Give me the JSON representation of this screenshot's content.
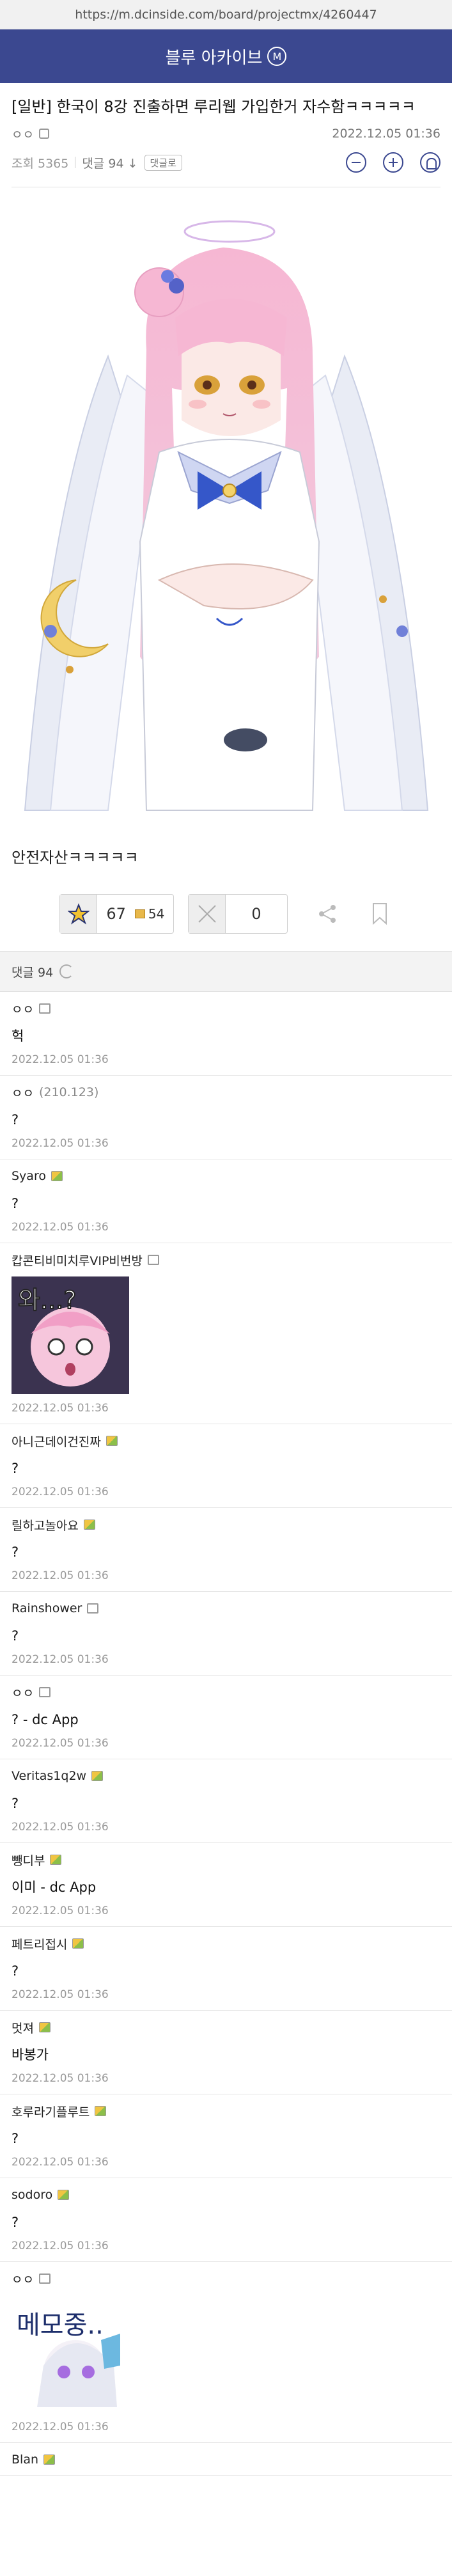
{
  "browser": {
    "url": "https://m.dcinside.com/board/projectmx/4260447"
  },
  "header": {
    "title": "블루 아카이브",
    "badge": "M"
  },
  "post": {
    "title": "[일반] 한국이 8강 진출하면 루리웹 가입한거 자수함ㅋㅋㅋㅋㅋ",
    "author": "ㅇㅇ",
    "datetime": "2022.12.05 01:36",
    "views": "조회 5365",
    "comments_link": "댓글 94",
    "tag_button": "댓글로",
    "body": "안전자산ㅋㅋㅋㅋㅋ"
  },
  "votes": {
    "up": "67",
    "gallery_up": "54",
    "down": "0"
  },
  "comments_header": "댓글 94",
  "comments": [
    {
      "author": "ㅇㅇ",
      "ip": "",
      "badge": "fixed",
      "text": "헉",
      "date": "2022.12.05 01:36",
      "image": ""
    },
    {
      "author": "ㅇㅇ",
      "ip": "(210.123)",
      "badge": "",
      "text": "?",
      "date": "2022.12.05 01:36",
      "image": ""
    },
    {
      "author": "Syaro",
      "ip": "",
      "badge": "half",
      "text": "?",
      "date": "2022.12.05 01:36",
      "image": ""
    },
    {
      "author": "캅콘티비미치루VIP비번방",
      "ip": "",
      "badge": "fixed",
      "text": "",
      "date": "2022.12.05 01:36",
      "image": "sticker-surprised"
    },
    {
      "author": "아니근데이건진짜",
      "ip": "",
      "badge": "half",
      "text": "?",
      "date": "2022.12.05 01:36",
      "image": ""
    },
    {
      "author": "릴하고놀아요",
      "ip": "",
      "badge": "half",
      "text": "?",
      "date": "2022.12.05 01:36",
      "image": ""
    },
    {
      "author": "Rainshower",
      "ip": "",
      "badge": "fixed",
      "text": "?",
      "date": "2022.12.05 01:36",
      "image": ""
    },
    {
      "author": "ㅇㅇ",
      "ip": "",
      "badge": "fixed",
      "text": "? - dc App",
      "date": "2022.12.05 01:36",
      "image": ""
    },
    {
      "author": "Veritas1q2w",
      "ip": "",
      "badge": "half",
      "text": "?",
      "date": "2022.12.05 01:36",
      "image": ""
    },
    {
      "author": "뺑디부",
      "ip": "",
      "badge": "half",
      "text": "이미 - dc App",
      "date": "2022.12.05 01:36",
      "image": ""
    },
    {
      "author": "페트리접시",
      "ip": "",
      "badge": "half",
      "text": "?",
      "date": "2022.12.05 01:36",
      "image": ""
    },
    {
      "author": "멋져",
      "ip": "",
      "badge": "half",
      "text": "바봉가",
      "date": "2022.12.05 01:36",
      "image": ""
    },
    {
      "author": "호루라기플루트",
      "ip": "",
      "badge": "half",
      "text": "?",
      "date": "2022.12.05 01:36",
      "image": ""
    },
    {
      "author": "sodoro",
      "ip": "",
      "badge": "half",
      "text": "?",
      "date": "2022.12.05 01:36",
      "image": ""
    },
    {
      "author": "ㅇㅇ",
      "ip": "",
      "badge": "fixed",
      "text": "",
      "date": "2022.12.05 01:36",
      "image": "sticker-memo"
    },
    {
      "author": "Blan",
      "ip": "",
      "badge": "half",
      "text": "",
      "date": "",
      "image": ""
    }
  ]
}
